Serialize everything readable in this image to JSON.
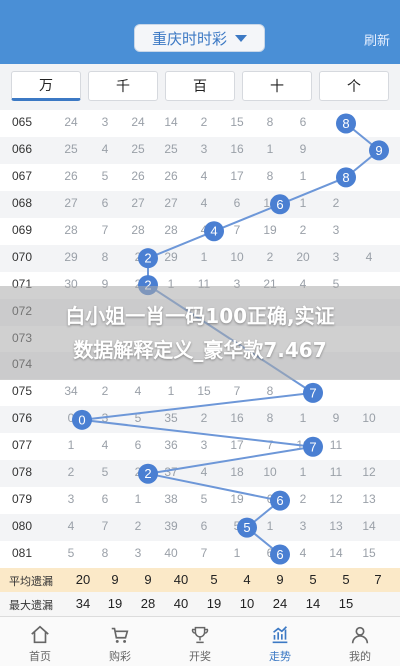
{
  "header": {
    "title": "重庆时时彩",
    "refresh": "刷新"
  },
  "tabs": [
    "万",
    "千",
    "百",
    "十",
    "个"
  ],
  "rows": [
    {
      "issue": "065",
      "vals": [
        "24",
        "3",
        "24",
        "14",
        "2",
        "15",
        "8",
        "6"
      ]
    },
    {
      "issue": "066",
      "vals": [
        "25",
        "4",
        "25",
        "25",
        "3",
        "16",
        "1",
        "9"
      ]
    },
    {
      "issue": "067",
      "vals": [
        "26",
        "5",
        "26",
        "26",
        "4",
        "17",
        "8",
        "1"
      ]
    },
    {
      "issue": "068",
      "vals": [
        "27",
        "6",
        "27",
        "27",
        "4",
        "6",
        "18",
        "1",
        "2"
      ]
    },
    {
      "issue": "069",
      "vals": [
        "28",
        "7",
        "28",
        "28",
        "4",
        "7",
        "19",
        "2",
        "3"
      ]
    },
    {
      "issue": "070",
      "vals": [
        "29",
        "8",
        "2",
        "29",
        "1",
        "10",
        "2",
        "20",
        "3",
        "4"
      ]
    },
    {
      "issue": "071",
      "vals": [
        "30",
        "9",
        "2",
        "1",
        "11",
        "3",
        "21",
        "4",
        "5"
      ]
    },
    {
      "issue": "072",
      "vals": [
        "",
        "",
        "",
        "",
        "",
        "",
        "",
        ""
      ]
    },
    {
      "issue": "073",
      "vals": [
        "",
        "",
        "",
        "",
        "",
        "",
        "",
        ""
      ]
    },
    {
      "issue": "074",
      "vals": [
        "",
        "",
        "",
        "",
        "",
        "",
        "",
        ""
      ]
    },
    {
      "issue": "075",
      "vals": [
        "34",
        "2",
        "4",
        "1",
        "15",
        "7",
        "8"
      ]
    },
    {
      "issue": "076",
      "vals": [
        "0",
        "3",
        "5",
        "35",
        "2",
        "16",
        "8",
        "1",
        "9",
        "10"
      ]
    },
    {
      "issue": "077",
      "vals": [
        "1",
        "4",
        "6",
        "36",
        "3",
        "17",
        "7",
        "10",
        "11"
      ]
    },
    {
      "issue": "078",
      "vals": [
        "2",
        "5",
        "2",
        "37",
        "4",
        "18",
        "10",
        "1",
        "11",
        "12"
      ]
    },
    {
      "issue": "079",
      "vals": [
        "3",
        "6",
        "1",
        "38",
        "5",
        "19",
        "6",
        "2",
        "12",
        "13"
      ]
    },
    {
      "issue": "080",
      "vals": [
        "4",
        "7",
        "2",
        "39",
        "6",
        "5",
        "1",
        "3",
        "13",
        "14"
      ]
    },
    {
      "issue": "081",
      "vals": [
        "5",
        "8",
        "3",
        "40",
        "7",
        "1",
        "6",
        "4",
        "14",
        "15"
      ]
    }
  ],
  "overlay": {
    "line1": "白小姐一肖一码100正确,实证",
    "line2": "数据解释定义_豪华款7.467"
  },
  "stats": {
    "avg_label": "平均遗漏",
    "avg": [
      "20",
      "9",
      "9",
      "40",
      "5",
      "4",
      "9",
      "5",
      "5",
      "7"
    ],
    "max_label": "最大遗漏",
    "max": [
      "34",
      "19",
      "28",
      "40",
      "19",
      "10",
      "24",
      "14",
      "15"
    ]
  },
  "nav": [
    {
      "label": "首页",
      "icon": "home-icon"
    },
    {
      "label": "购彩",
      "icon": "cart-icon"
    },
    {
      "label": "开奖",
      "icon": "trophy-icon"
    },
    {
      "label": "走势",
      "icon": "trend-icon"
    },
    {
      "label": "我的",
      "icon": "user-icon"
    }
  ],
  "balls": [
    {
      "issue": "065",
      "digit": "8"
    },
    {
      "issue": "066",
      "digit": "9"
    },
    {
      "issue": "067",
      "digit": "8"
    },
    {
      "issue": "068",
      "digit": "6"
    },
    {
      "issue": "069",
      "digit": "4"
    },
    {
      "issue": "070",
      "digit": "2"
    },
    {
      "issue": "071",
      "digit": "2"
    },
    {
      "issue": "075",
      "digit": "7"
    },
    {
      "issue": "076",
      "digit": "0"
    },
    {
      "issue": "077",
      "digit": "7"
    },
    {
      "issue": "078",
      "digit": "2"
    },
    {
      "issue": "079",
      "digit": "6"
    },
    {
      "issue": "080",
      "digit": "5"
    },
    {
      "issue": "081",
      "digit": "6"
    }
  ],
  "colors": {
    "header": "#4a8fd6",
    "ball": "#4a7fd2",
    "line": "#6d97d8"
  }
}
